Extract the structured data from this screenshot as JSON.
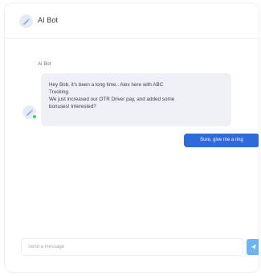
{
  "header": {
    "title": "AI Bot",
    "avatar_icon": "robot-icon"
  },
  "conversation": {
    "bot_sender_name": "AI Bot",
    "bot_message_lines": [
      "Hey Bob, it's been a long time.. Alex here with ABC",
      "Trucking.",
      "We just increased our OTR Driver pay, and added some",
      "bonuses! Interested?"
    ],
    "user_message": "Sure, give me a ring"
  },
  "composer": {
    "placeholder": "Send a message",
    "value": "",
    "send_icon": "send-icon"
  },
  "colors": {
    "accent": "#2f6ad9",
    "send_button": "#6cb4f6",
    "bot_bubble": "#eef0f5",
    "online": "#4cc36a"
  }
}
